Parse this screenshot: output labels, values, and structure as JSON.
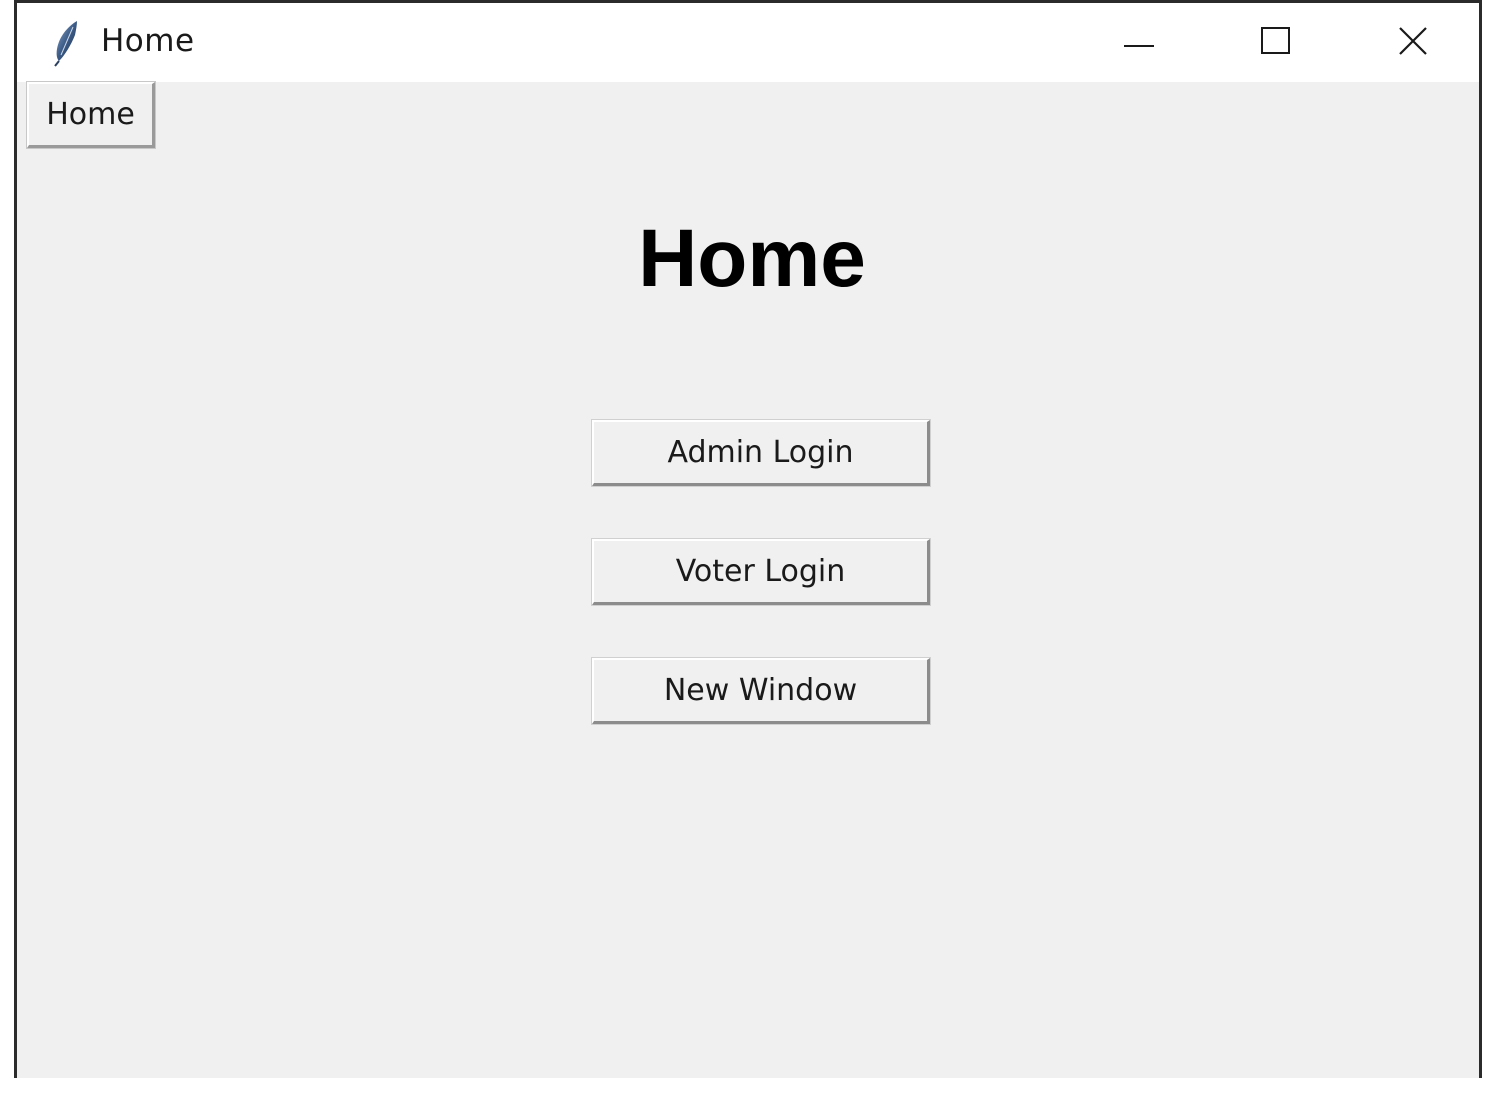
{
  "window": {
    "title": "Home",
    "icon": "feather-icon",
    "controls": {
      "minimize": "minimize-icon",
      "maximize": "maximize-icon",
      "close": "close-icon"
    }
  },
  "menu": {
    "home_label": "Home"
  },
  "main": {
    "heading": "Home",
    "buttons": [
      {
        "label": "Admin Login"
      },
      {
        "label": "Voter Login"
      },
      {
        "label": "New Window"
      }
    ]
  },
  "colors": {
    "background": "#f0f0f0",
    "titlebar": "#ffffff",
    "text": "#000000"
  }
}
